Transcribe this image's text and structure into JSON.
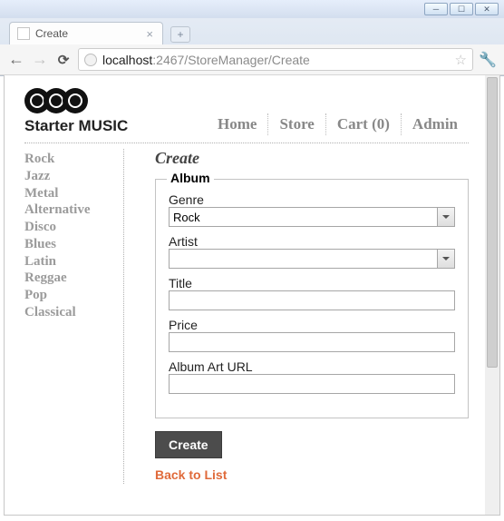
{
  "browser": {
    "tab_title": "Create",
    "url_host": "localhost",
    "url_port_path": ":2467/StoreManager/Create"
  },
  "site": {
    "brand": "Starter MUSIC",
    "nav": [
      "Home",
      "Store",
      "Cart (0)",
      "Admin"
    ]
  },
  "sidebar": {
    "items": [
      "Rock",
      "Jazz",
      "Metal",
      "Alternative",
      "Disco",
      "Blues",
      "Latin",
      "Reggae",
      "Pop",
      "Classical"
    ]
  },
  "page": {
    "title": "Create",
    "legend": "Album",
    "fields": {
      "genre": {
        "label": "Genre",
        "value": "Rock"
      },
      "artist": {
        "label": "Artist",
        "value": ""
      },
      "title": {
        "label": "Title",
        "value": ""
      },
      "price": {
        "label": "Price",
        "value": ""
      },
      "art_url": {
        "label": "Album Art URL",
        "value": ""
      }
    },
    "submit_label": "Create",
    "back_link": "Back to List"
  }
}
